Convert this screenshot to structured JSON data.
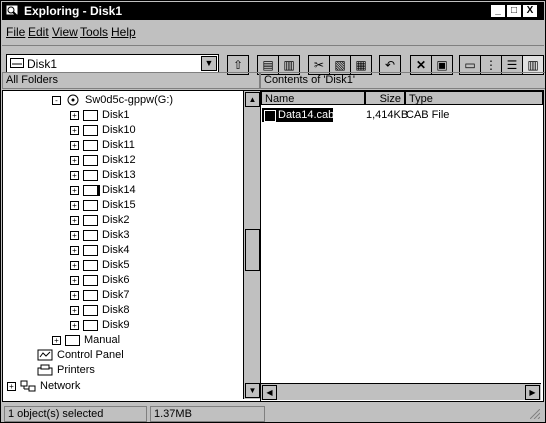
{
  "window": {
    "title": "Exploring - Disk1",
    "buttons": [
      "_",
      "□",
      "X"
    ]
  },
  "menu": [
    {
      "label": "File"
    },
    {
      "label": "Edit"
    },
    {
      "label": "View"
    },
    {
      "label": "Tools"
    },
    {
      "label": "Help"
    }
  ],
  "toolbar": {
    "address": "Disk1",
    "buttons": [
      "up-folder",
      "map-drive",
      "disconnect-drive",
      "cut",
      "copy",
      "paste",
      "undo",
      "delete",
      "properties",
      "large-icons",
      "small-icons",
      "list",
      "details"
    ]
  },
  "panes": {
    "left_header": "All Folders",
    "right_header": "Contents of 'Disk1'"
  },
  "tree": [
    {
      "label": "Sw0d5c-gppw(G:)",
      "level": 2,
      "expander": "-"
    },
    {
      "label": "Disk1",
      "level": 3,
      "expander": "+"
    },
    {
      "label": "Disk10",
      "level": 3,
      "expander": "+"
    },
    {
      "label": "Disk11",
      "level": 3,
      "expander": "+"
    },
    {
      "label": "Disk12",
      "level": 3,
      "expander": "+"
    },
    {
      "label": "Disk13",
      "level": 3,
      "expander": "+"
    },
    {
      "label": "Disk14",
      "level": 3,
      "expander": "+"
    },
    {
      "label": "Disk15",
      "level": 3,
      "expander": "+"
    },
    {
      "label": "Disk2",
      "level": 3,
      "expander": "+"
    },
    {
      "label": "Disk3",
      "level": 3,
      "expander": "+"
    },
    {
      "label": "Disk4",
      "level": 3,
      "expander": "+"
    },
    {
      "label": "Disk5",
      "level": 3,
      "expander": "+"
    },
    {
      "label": "Disk6",
      "level": 3,
      "expander": "+"
    },
    {
      "label": "Disk7",
      "level": 3,
      "expander": "+"
    },
    {
      "label": "Disk8",
      "level": 3,
      "expander": "+"
    },
    {
      "label": "Disk9",
      "level": 3,
      "expander": "+"
    },
    {
      "label": "Manual",
      "level": 2,
      "expander": "+"
    },
    {
      "label": "Control Panel",
      "level": 1,
      "expander": ""
    },
    {
      "label": "Printers",
      "level": 1,
      "expander": ""
    },
    {
      "label": "Network",
      "level": 0,
      "expander": "+"
    }
  ],
  "contents": {
    "columns": [
      "Name",
      "Size",
      "Type"
    ],
    "rows": [
      {
        "name": "Data14.cab",
        "size": "1,414KB",
        "type": "CAB File",
        "selected": true
      }
    ]
  },
  "status": {
    "left": "1 object(s) selected",
    "right": "1.37MB"
  }
}
